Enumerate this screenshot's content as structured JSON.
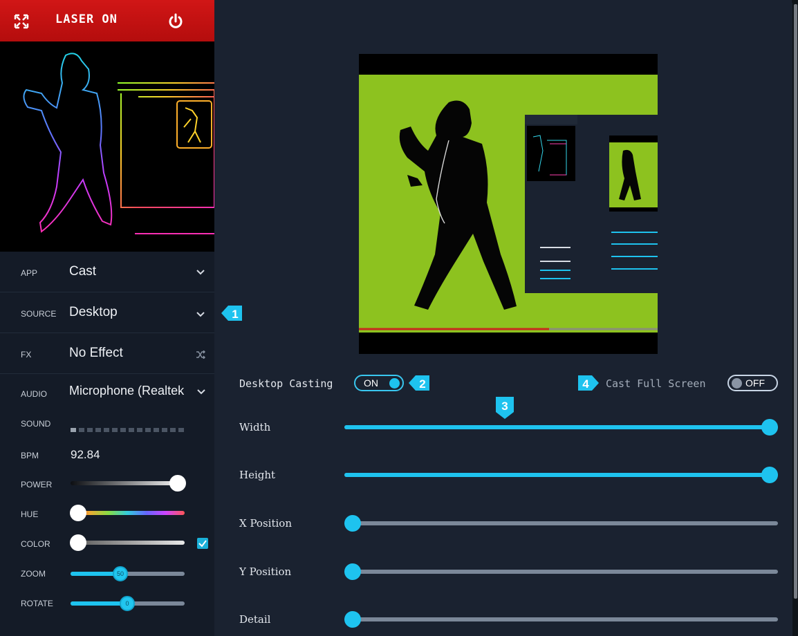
{
  "header": {
    "laser_label": "LASER ON",
    "expand_icon": "fullscreen-icon",
    "power_icon": "power-icon",
    "color": "#c91111"
  },
  "sidebar": {
    "app": {
      "label": "APP",
      "value": "Cast"
    },
    "source": {
      "label": "SOURCE",
      "value": "Desktop"
    },
    "fx": {
      "label": "FX",
      "value": "No Effect"
    },
    "audio": {
      "label": "AUDIO",
      "value": "Microphone (Realtek"
    },
    "sound": {
      "label": "SOUND"
    },
    "bpm": {
      "label": "BPM",
      "value": "92.84"
    },
    "power": {
      "label": "POWER",
      "level": 1.0
    },
    "hue": {
      "label": "HUE",
      "level": 0.0
    },
    "color": {
      "label": "COLOR",
      "level": 0.0,
      "checked": true
    },
    "zoom": {
      "label": "ZOOM",
      "value": "50"
    },
    "rotate": {
      "label": "ROTATE",
      "value": "0"
    }
  },
  "main": {
    "desktop_casting": {
      "label": "Desktop Casting",
      "state": "ON"
    },
    "cast_full_screen": {
      "label": "Cast Full Screen",
      "state": "OFF"
    },
    "sliders": [
      {
        "label": "Width",
        "level": 1.0
      },
      {
        "label": "Height",
        "level": 1.0
      },
      {
        "label": "X Position",
        "level": 0.0
      },
      {
        "label": "Y Position",
        "level": 0.0
      },
      {
        "label": "Detail",
        "level": 0.0
      }
    ],
    "badges": [
      "1",
      "2",
      "3",
      "4"
    ]
  },
  "colors": {
    "accent": "#1ec3ef",
    "background": "#1a2230",
    "sidebar": "#141b27",
    "green_screen": "#8dc21f"
  }
}
